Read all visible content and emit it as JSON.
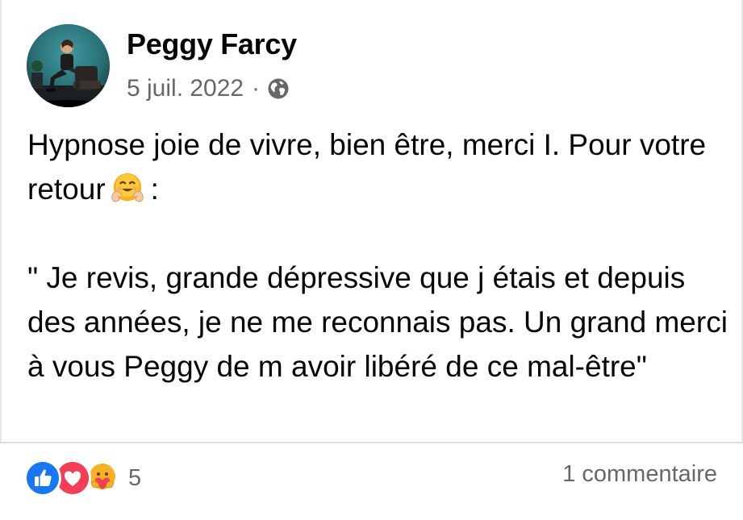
{
  "post": {
    "author": "Peggy Farcy",
    "date": "5 juil. 2022",
    "separator": "·",
    "privacy_icon": "globe-icon",
    "text": {
      "line1_before_emoji": "Hypnose joie de vivre, bien être, merci I. Pour votre retour",
      "line1_emoji": "hugging-face-emoji",
      "line1_after_emoji": ":",
      "quote": "\" Je revis, grande dépressive que j étais et depuis des années, je ne me reconnais pas. Un grand merci à vous Peggy de m avoir libéré de ce mal-être\""
    }
  },
  "footer": {
    "reaction_icons": [
      "like-icon",
      "love-icon",
      "care-icon"
    ],
    "reaction_count": "5",
    "comments": "1 commentaire"
  },
  "colors": {
    "text_primary": "#050505",
    "text_secondary": "#65676b",
    "like_blue": "#1877f2",
    "love_red": "#f33e58",
    "care_yellow": "#f7b125",
    "divider": "#dadde1"
  }
}
